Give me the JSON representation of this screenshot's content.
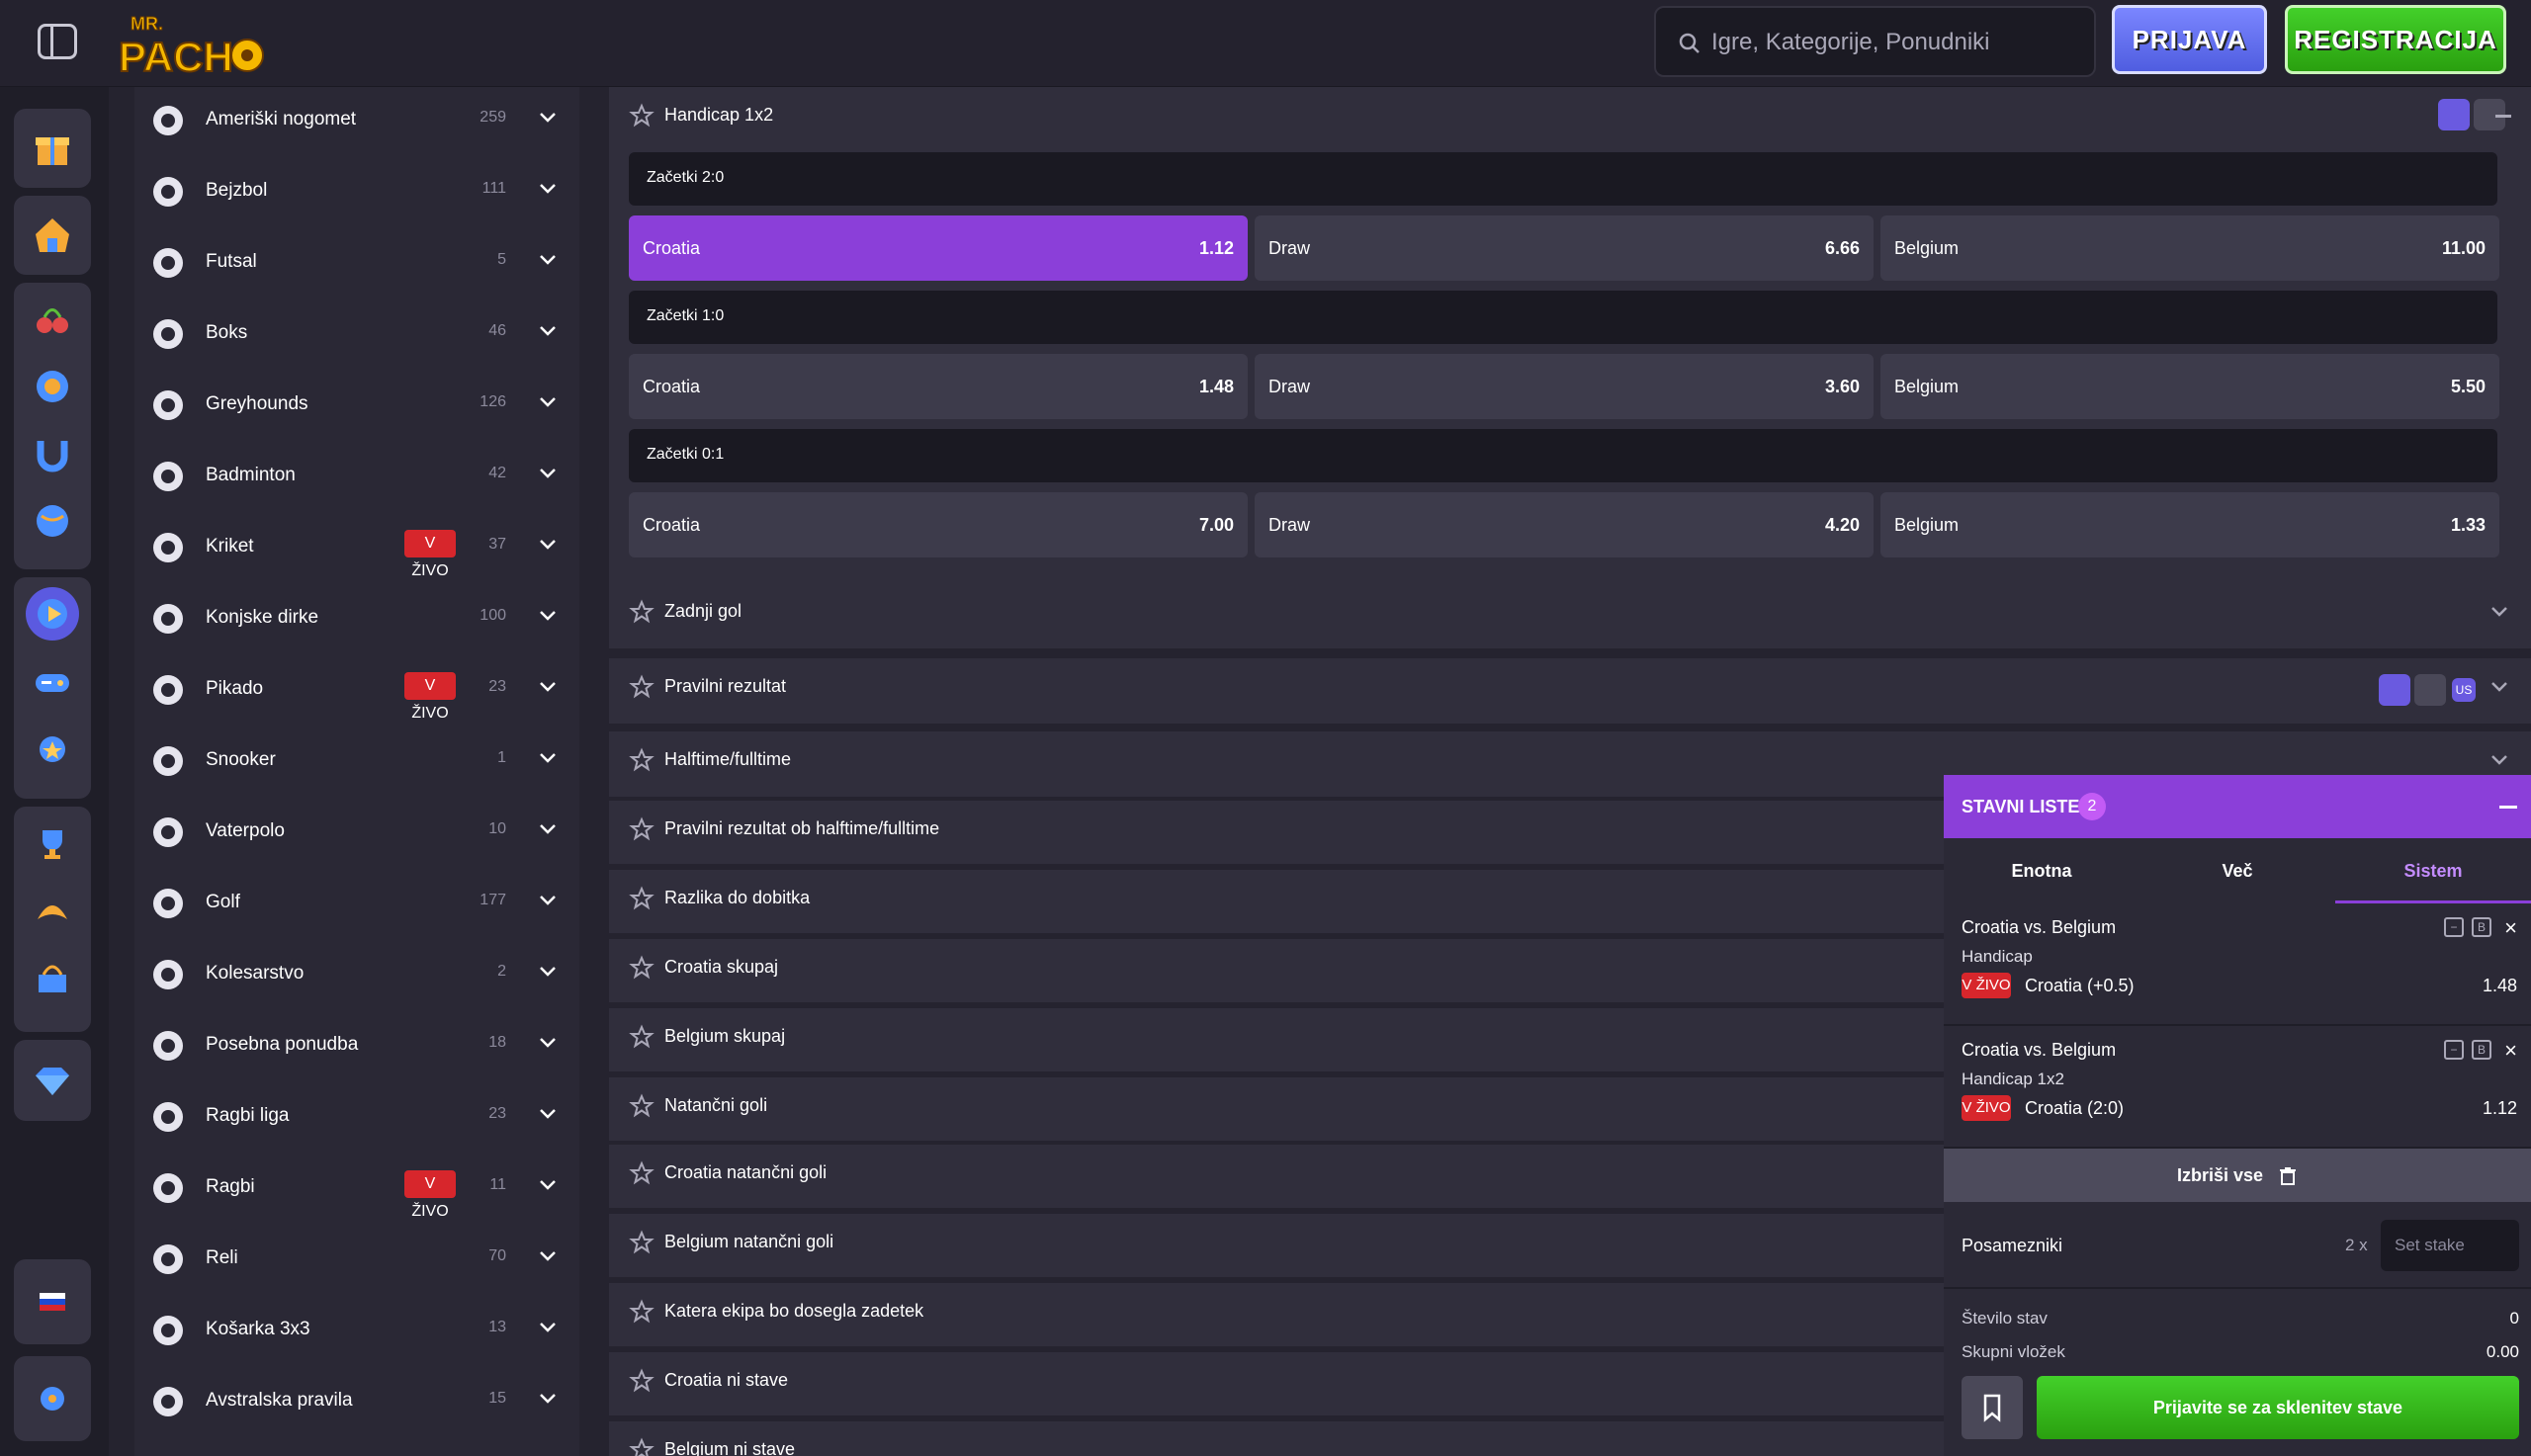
{
  "header": {
    "brand": "MR. PACHO",
    "search_placeholder": "Igre, Kategorije, Ponudniki",
    "login_label": "PRIJAVA",
    "register_label": "REGISTRACIJA"
  },
  "sports": [
    {
      "name": "Ameriški nogomet",
      "count": "259",
      "live": ""
    },
    {
      "name": "Bejzbol",
      "count": "111",
      "live": ""
    },
    {
      "name": "Futsal",
      "count": "5",
      "live": ""
    },
    {
      "name": "Boks",
      "count": "46",
      "live": ""
    },
    {
      "name": "Greyhounds",
      "count": "126",
      "live": ""
    },
    {
      "name": "Badminton",
      "count": "42",
      "live": ""
    },
    {
      "name": "Kriket",
      "count": "37",
      "live": "V ŽIVO"
    },
    {
      "name": "Konjske dirke",
      "count": "100",
      "live": ""
    },
    {
      "name": "Pikado",
      "count": "23",
      "live": "V ŽIVO"
    },
    {
      "name": "Snooker",
      "count": "1",
      "live": ""
    },
    {
      "name": "Vaterpolo",
      "count": "10",
      "live": ""
    },
    {
      "name": "Golf",
      "count": "177",
      "live": ""
    },
    {
      "name": "Kolesarstvo",
      "count": "2",
      "live": ""
    },
    {
      "name": "Posebna ponudba",
      "count": "18",
      "live": ""
    },
    {
      "name": "Ragbi liga",
      "count": "23",
      "live": ""
    },
    {
      "name": "Ragbi",
      "count": "11",
      "live": "V ŽIVO"
    },
    {
      "name": "Reli",
      "count": "70",
      "live": ""
    },
    {
      "name": "Košarka 3x3",
      "count": "13",
      "live": ""
    },
    {
      "name": "Avstralska pravila",
      "count": "15",
      "live": ""
    }
  ],
  "handicap": {
    "title": "Handicap 1x2",
    "groups": [
      {
        "label": "Začetki 2:0",
        "odds": [
          {
            "name": "Croatia",
            "value": "1.12"
          },
          {
            "name": "Draw",
            "value": "6.66"
          },
          {
            "name": "Belgium",
            "value": "11.00"
          }
        ]
      },
      {
        "label": "Začetki 1:0",
        "odds": [
          {
            "name": "Croatia",
            "value": "1.48"
          },
          {
            "name": "Draw",
            "value": "3.60"
          },
          {
            "name": "Belgium",
            "value": "5.50"
          }
        ]
      },
      {
        "label": "Začetki 0:1",
        "odds": [
          {
            "name": "Croatia",
            "value": "7.00"
          },
          {
            "name": "Draw",
            "value": "4.20"
          },
          {
            "name": "Belgium",
            "value": "1.33"
          }
        ]
      }
    ]
  },
  "markets": [
    "Zadnji gol",
    "Pravilni rezultat",
    "Halftime/fulltime",
    "Pravilni rezultat ob halftime/fulltime",
    "Razlika do dobitka",
    "Croatia skupaj",
    "Belgium skupaj",
    "Natančni goli",
    "Croatia natančni goli",
    "Belgium natančni goli",
    "Katera ekipa bo dosegla zadetek",
    "Croatia ni stave",
    "Belgium ni stave"
  ],
  "odds_format_badge": "US",
  "betslip": {
    "title": "STAVNI LISTEK",
    "count": "2",
    "tabs": [
      "Enotna",
      "Več",
      "Sistem"
    ],
    "bets": [
      {
        "match": "Croatia vs. Belgium",
        "market": "Handicap",
        "live": "V ŽIVO",
        "pick": "Croatia (+0.5)",
        "odds": "1.48"
      },
      {
        "match": "Croatia vs. Belgium",
        "market": "Handicap 1x2",
        "live": "V ŽIVO",
        "pick": "Croatia (2:0)",
        "odds": "1.12"
      }
    ],
    "clear_all": "Izbriši vse",
    "singles_label": "Posamezniki",
    "multiplier": "2 x",
    "stake_placeholder": "Set stake",
    "num_bets_label": "Število stav",
    "num_bets_value": "0",
    "total_stake_label": "Skupni vložek",
    "total_stake_value": "0.00",
    "submit_label": "Prijavite se za sklenitev stave"
  },
  "colors": {
    "accent": "#8b3fd9",
    "live": "#d7262c",
    "green": "#2aa00f",
    "login": "#5b68e8"
  }
}
